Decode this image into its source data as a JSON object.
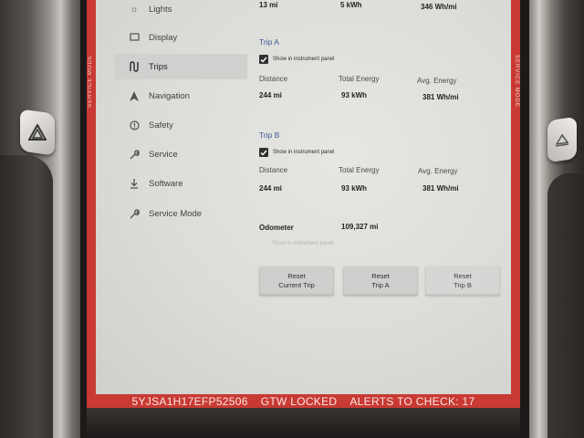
{
  "side_labels": {
    "left": "SERVICE MODE",
    "right": "SERVICE MODE"
  },
  "sidebar": {
    "items": [
      {
        "label": "Lights",
        "icon": "sun-icon"
      },
      {
        "label": "Display",
        "icon": "display-icon"
      },
      {
        "label": "Trips",
        "icon": "trips-icon",
        "active": true
      },
      {
        "label": "Navigation",
        "icon": "navigation-arrow-icon"
      },
      {
        "label": "Safety",
        "icon": "safety-icon"
      },
      {
        "label": "Service",
        "icon": "wrench-icon"
      },
      {
        "label": "Software",
        "icon": "download-icon"
      },
      {
        "label": "Service Mode",
        "icon": "wrench-icon"
      }
    ]
  },
  "current_trip": {
    "distance": "13 mi",
    "energy": "5 kWh",
    "avg": "346 Wh/mi"
  },
  "trip_a": {
    "title": "Trip A",
    "show_label": "Show in instrument panel",
    "headers": {
      "distance": "Distance",
      "energy": "Total Energy",
      "avg": "Avg. Energy"
    },
    "distance": "244 mi",
    "energy": "93 kWh",
    "avg": "381 Wh/mi"
  },
  "trip_b": {
    "title": "Trip B",
    "show_label": "Show in instrument panel",
    "headers": {
      "distance": "Distance",
      "energy": "Total Energy",
      "avg": "Avg. Energy"
    },
    "distance": "244 mi",
    "energy": "93 kWh",
    "avg": "381 Wh/mi"
  },
  "odometer": {
    "label": "Odometer",
    "value": "109,327 mi",
    "show_label": "Show in instrument panel"
  },
  "buttons": {
    "reset_current_1": "Reset",
    "reset_current_2": "Current Trip",
    "reset_a_1": "Reset",
    "reset_a_2": "Trip A",
    "reset_b_1": "Reset",
    "reset_b_2": "Trip B"
  },
  "status_bar": {
    "vin": "5YJSA1H17EFP52506",
    "gtw": "GTW LOCKED",
    "alerts": "ALERTS TO CHECK: 17"
  },
  "colors": {
    "frame_red": "#c83a33",
    "section_title": "#3e5a9c",
    "screen_bg": "#e0e0dc"
  }
}
